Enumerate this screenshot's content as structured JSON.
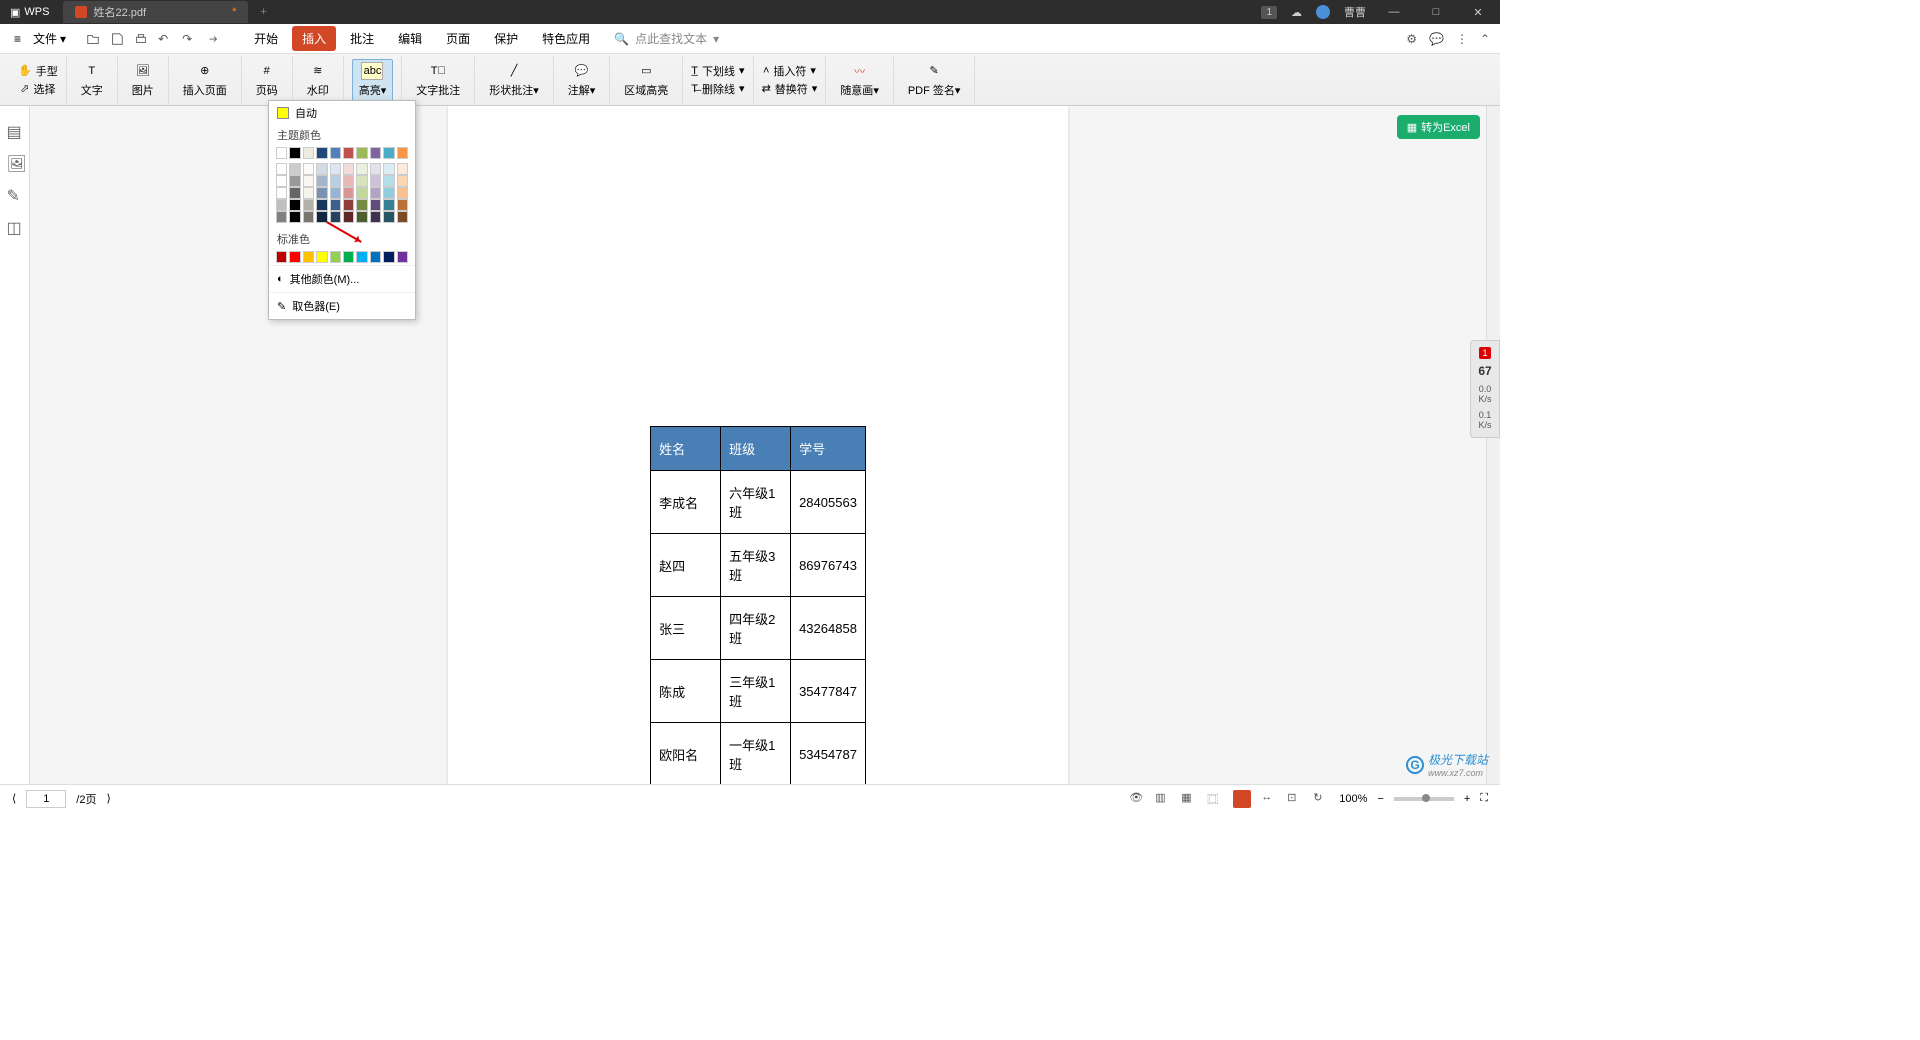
{
  "titlebar": {
    "app_name": "WPS",
    "tab_filename": "姓名22.pdf",
    "tab_modified": "*",
    "badge_number": "1",
    "user_name": "曹曹"
  },
  "menubar": {
    "file_label": "文件",
    "tabs": [
      "开始",
      "插入",
      "批注",
      "编辑",
      "页面",
      "保护",
      "特色应用"
    ],
    "active_tab_index": 1,
    "search_placeholder": "点此查找文本"
  },
  "ribbon": {
    "hand_tool": "手型",
    "select_tool": "选择",
    "text": "文字",
    "image": "图片",
    "insert_page": "插入页面",
    "page_number": "页码",
    "watermark": "水印",
    "highlight": "高亮",
    "text_annotation": "文字批注",
    "shape_annotation": "形状批注",
    "annotation": "注解",
    "area_highlight": "区域高亮",
    "underline": "下划线",
    "insert_symbol": "插入符",
    "strikethrough": "删除线",
    "replace_symbol": "替换符",
    "freehand": "随意画",
    "pdf_sign": "PDF 签名"
  },
  "color_dropdown": {
    "auto_label": "自动",
    "theme_label": "主题颜色",
    "standard_label": "标准色",
    "more_colors": "其他颜色(M)...",
    "eyedropper": "取色器(E)",
    "theme_colors": [
      "#ffffff",
      "#000000",
      "#eeece1",
      "#1f497d",
      "#4f81bd",
      "#c0504d",
      "#9bbb59",
      "#8064a2",
      "#4bacc6",
      "#f79646"
    ],
    "standard_colors": [
      "#c00000",
      "#ff0000",
      "#ffc000",
      "#ffff00",
      "#92d050",
      "#00b050",
      "#00b0f0",
      "#0070c0",
      "#002060",
      "#7030a0"
    ]
  },
  "document": {
    "table_headers": [
      "姓名",
      "班级",
      "学号"
    ],
    "table_rows": [
      {
        "name": "李成名",
        "class": "六年级1班",
        "id": "28405563"
      },
      {
        "name": "赵四",
        "class": "五年级3班",
        "id": "86976743"
      },
      {
        "name": "张三",
        "class": "四年级2班",
        "id": "43264858"
      },
      {
        "name": "陈成",
        "class": "三年级1班",
        "id": "35477847"
      },
      {
        "name": "欧阳名",
        "class": "一年级1班",
        "id": "53454787"
      }
    ]
  },
  "convert_button": "转为Excel",
  "side_widget": {
    "badge": "1",
    "stat1_val": "67",
    "stat2_val": "0.0",
    "stat2_unit": "K/s",
    "stat3_val": "0.1",
    "stat3_unit": "K/s"
  },
  "statusbar": {
    "current_page": "1",
    "total_pages": "/2页",
    "zoom": "100%"
  },
  "watermark_text": "极光下载站",
  "watermark_url": "www.xz7.com"
}
